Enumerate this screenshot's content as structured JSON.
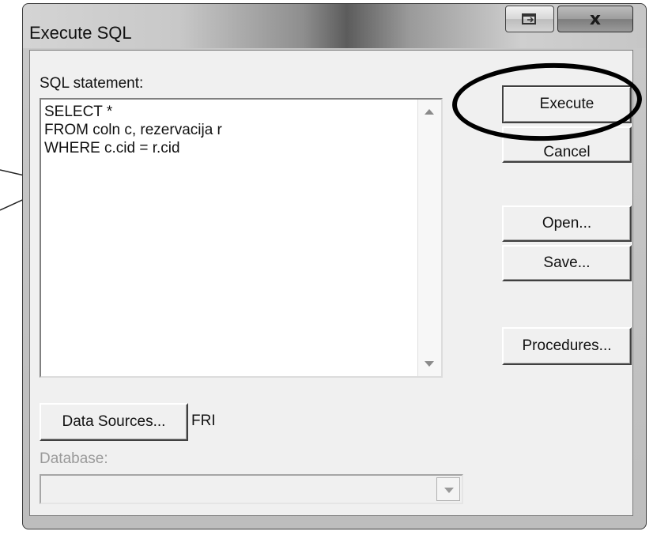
{
  "window": {
    "title": "Execute SQL",
    "close_glyph": "x",
    "restore_icon": "restore-window-icon"
  },
  "sql": {
    "label": "SQL statement:",
    "text": "SELECT *\nFROM coln c, rezervacija r\nWHERE c.cid = r.cid"
  },
  "buttons": {
    "execute": "Execute",
    "cancel": "Cancel",
    "open": "Open...",
    "save": "Save...",
    "procedures": "Procedures...",
    "data_sources": "Data Sources..."
  },
  "data_source_value": "FRI",
  "database": {
    "label": "Database:",
    "selected": ""
  },
  "annotation": {
    "highlight_target": "execute-button"
  }
}
